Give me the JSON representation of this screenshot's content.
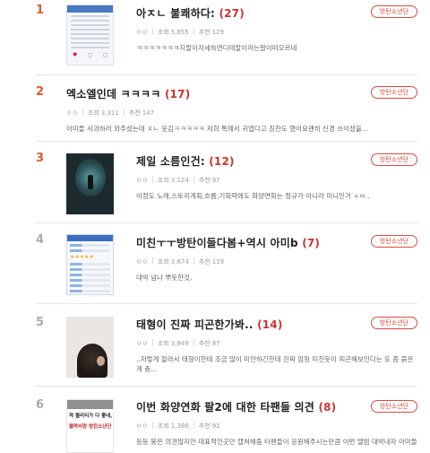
{
  "labels": {
    "views": "조회",
    "recommends": "추천"
  },
  "items": [
    {
      "rank": "1",
      "title": "아ㅈㄴ 불쾌하다:",
      "comments": "(27)",
      "author": "ㅇㅇ",
      "views": "5,855",
      "recommends": "129",
      "snippet": "ㅋㅋㅋㅋㅋㅋㅋ지랄이자세하면디테랄이라는말이떠오르네",
      "badge": "방탄소년단",
      "thumb": "screenshot-post",
      "thumb_text": []
    },
    {
      "rank": "2",
      "title": "엑소엘인데 ㅋㅋㅋㅋ",
      "comments": "(17)",
      "author": "ㅇㅇ",
      "views": "3,311",
      "recommends": "147",
      "snippet": "아미들 사과하러 와주셨는데 ㅈㄴ 웃김ㅋㅋㅋㅋㅋ 저희 톡에서 귀엽다고 칭찬도 했어요괜히 신경 쓰이셨을...",
      "badge": "방탄소년단",
      "thumb": null,
      "thumb_text": []
    },
    {
      "rank": "3",
      "title": "제일 소름인건:",
      "comments": "(12)",
      "author": "ㅇㅇ",
      "views": "3,124",
      "recommends": "97",
      "snippet": "이정도 노래,스토리계획,흐름,기획력에도 화양연화는 정규가 아니라 미니인거 ㅅㅂ..",
      "badge": "방탄소년단",
      "thumb": "dark-figure-photo",
      "thumb_text": []
    },
    {
      "rank": "4",
      "title": "미친ㅜㅜ방탄이들다봄+역시 아미b",
      "comments": "(7)",
      "author": "ㅇㅇ",
      "views": "3,674",
      "recommends": "119",
      "snippet": "대박 넘나 뿌듯한것.",
      "badge": "방탄소년단",
      "thumb": "chat-list-screenshot",
      "thumb_text": []
    },
    {
      "rank": "5",
      "title": "태형이 진짜 피곤한가봐..",
      "comments": "(14)",
      "author": "ㅇㅇ",
      "views": "3,849",
      "recommends": "87",
      "snippet": "..저렇게 잘라서 태형이한테 조금 많이 미안하긴한데 진짜 엄청 미친듯이 피곤해보인다는 또 좀 붉은 게 충...",
      "badge": "방탄소년단",
      "thumb": "person-photo",
      "thumb_text": []
    },
    {
      "rank": "6",
      "title": "이번 화양연화 팔2에 대한 타팬들 의견",
      "comments": "(8)",
      "author": "ㅇㅇ",
      "views": "1,386",
      "recommends": "91",
      "snippet": "등등 뭉은 의견많지만 대표적인곳만 캡쳐해줌 타팬들이 응원해주시는만큼 이번 앨범 대박내자 아미들",
      "badge": "방탄소년단",
      "thumb": "text-screenshot",
      "thumb_text": [
        "적 퀄리티가 다 좋네,",
        "블락비랑 방탄소년단"
      ]
    }
  ]
}
